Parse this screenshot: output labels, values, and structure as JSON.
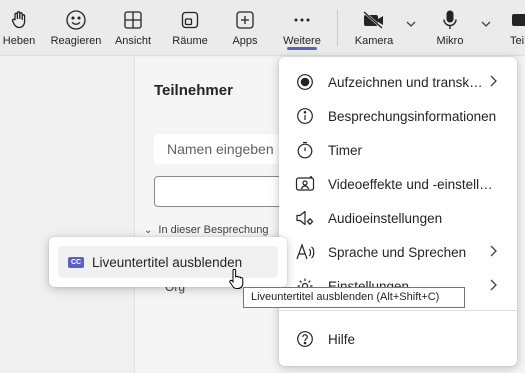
{
  "toolbar": {
    "items": [
      {
        "label": "Heben",
        "icon": "hand-icon"
      },
      {
        "label": "Reagieren",
        "icon": "smiley-icon"
      },
      {
        "label": "Ansicht",
        "icon": "grid-icon"
      },
      {
        "label": "Räume",
        "icon": "rooms-icon"
      },
      {
        "label": "Apps",
        "icon": "plus-icon"
      },
      {
        "label": "Weitere",
        "icon": "ellipsis-icon"
      },
      {
        "label": "Kamera",
        "icon": "camera-off-icon"
      },
      {
        "label": "Mikro",
        "icon": "mic-icon"
      },
      {
        "label": "Tei",
        "icon": "share-icon"
      }
    ],
    "accent": "#5b5fc7"
  },
  "panel": {
    "title": "Teilnehmer",
    "search_value": "Namen eingeben",
    "section": "In dieser Besprechung",
    "person_fragment": "Org"
  },
  "menu": {
    "items": [
      {
        "label": "Aufzeichnen und transk…",
        "icon": "record-icon",
        "submenu": true
      },
      {
        "label": "Besprechungsinformationen",
        "icon": "info-icon",
        "submenu": false
      },
      {
        "label": "Timer",
        "icon": "timer-icon",
        "submenu": false
      },
      {
        "label": "Videoeffekte und -einstellu…",
        "icon": "video-effects-icon",
        "submenu": false
      },
      {
        "label": "Audioeinstellungen",
        "icon": "speaker-settings-icon",
        "submenu": false
      },
      {
        "label": "Sprache und Sprechen",
        "icon": "language-icon",
        "submenu": true
      },
      {
        "label": "Einstellungen",
        "icon": "gear-icon",
        "submenu": true
      },
      {
        "label": "Hilfe",
        "icon": "help-icon",
        "submenu": false
      }
    ]
  },
  "submenu": {
    "badge": "CC",
    "item": "Liveuntertitel ausblenden"
  },
  "tooltip": "Liveuntertitel ausblenden (Alt+Shift+C)"
}
